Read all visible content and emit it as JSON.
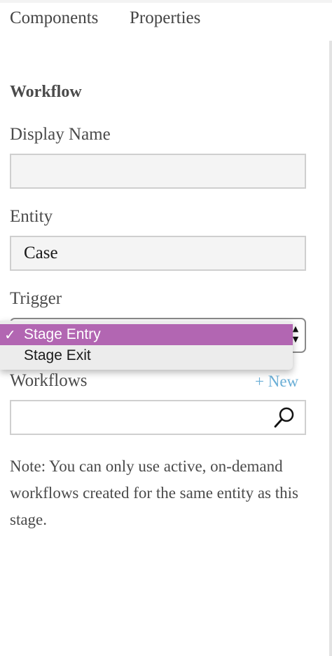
{
  "tabs": {
    "components": "Components",
    "properties": "Properties"
  },
  "section": {
    "title": "Workflow"
  },
  "display_name": {
    "label": "Display Name",
    "value": ""
  },
  "entity": {
    "label": "Entity",
    "value": "Case"
  },
  "trigger": {
    "label": "Trigger",
    "options": [
      {
        "label": "Stage Entry",
        "selected": true
      },
      {
        "label": "Stage Exit",
        "selected": false
      }
    ],
    "checkmark": "✓"
  },
  "workflows": {
    "label": "Workflows",
    "new_link": "+ New",
    "search_value": ""
  },
  "note": "Note: You can only use active, on-demand workflows created for the same entity as this stage.",
  "colors": {
    "selected_option": "#b266b2",
    "link": "#6aaed6"
  },
  "icons": {
    "search": "search-icon",
    "select_arrows": "select-arrows-icon",
    "check": "check-icon"
  }
}
